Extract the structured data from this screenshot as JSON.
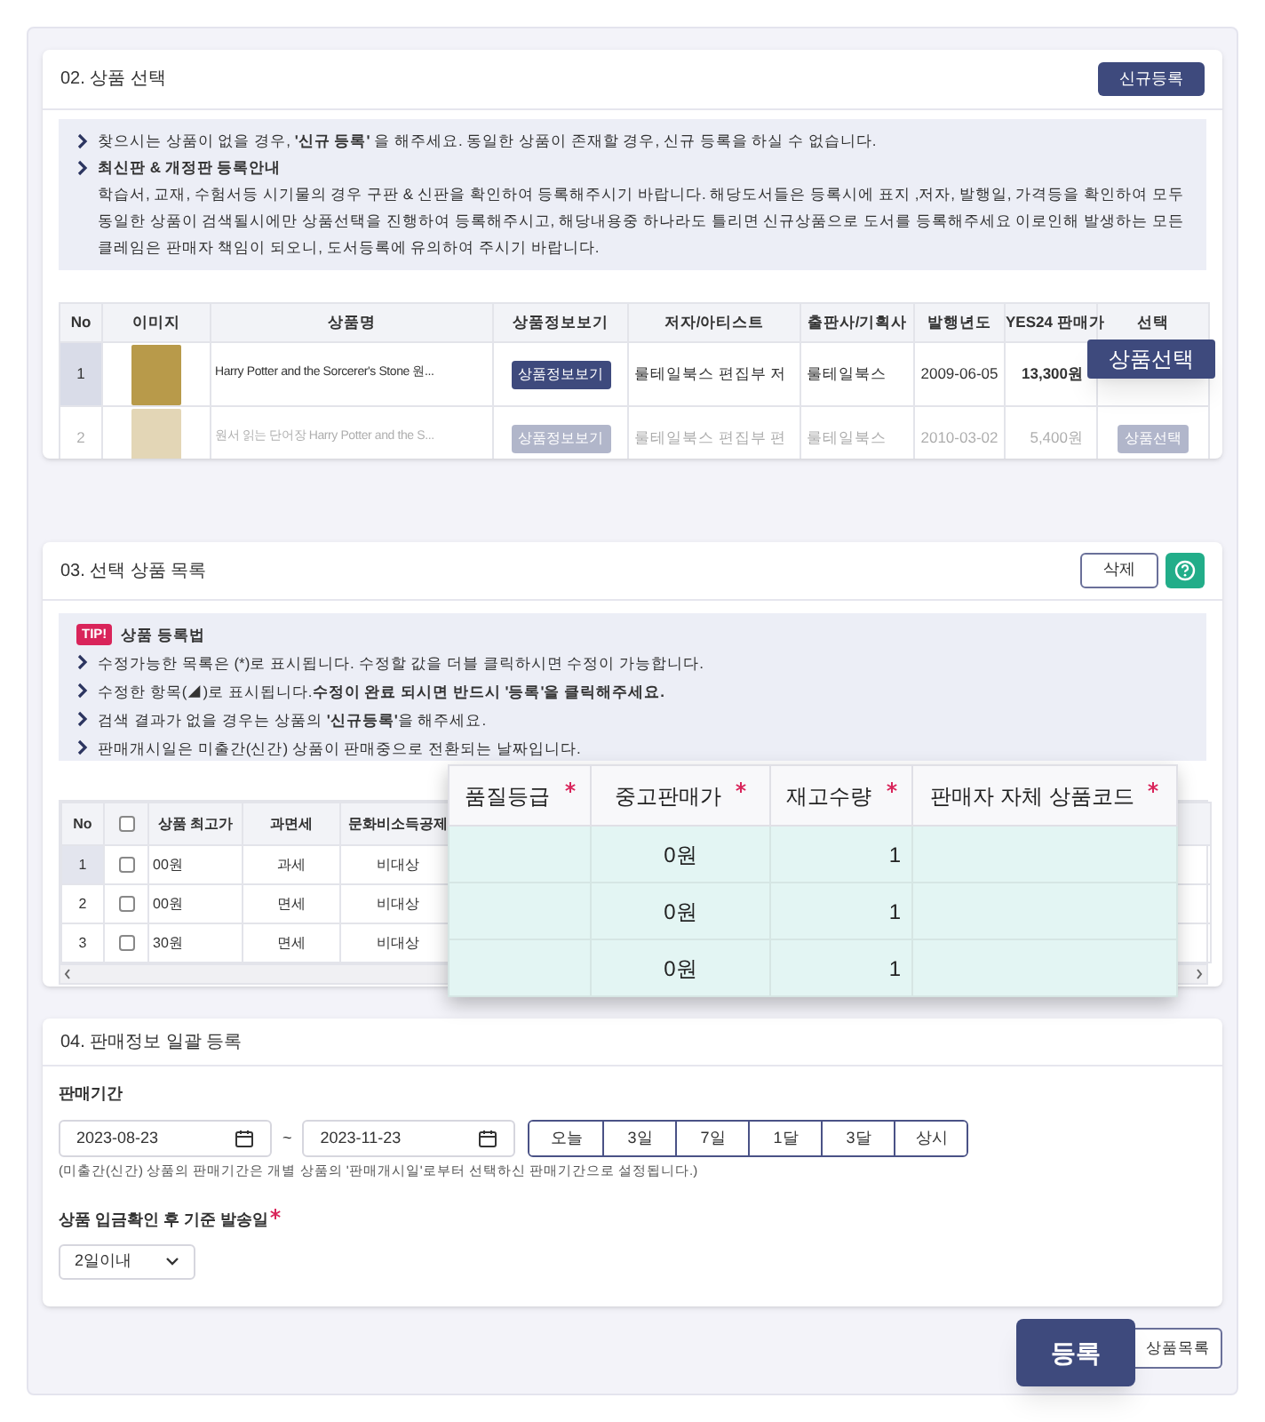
{
  "product_select": {
    "title": "02. 상품 선택",
    "new_button": "신규등록",
    "notices": [
      {
        "kind": "bullet",
        "text": "찾으시는 상품이 없을 경우, **'신규 등록'** 을 해주세요. 동일한 상품이 존재할 경우, 신규 등록을 하실 수 없습니다."
      },
      {
        "kind": "heading",
        "title": "최신판 & 개정판 등록안내",
        "body": "학습서, 교재, 수험서등 시기물의 경우 구판 & 신판을 확인하여 등록해주시기 바랍니다. 해당도서들은 등록시에 표지 ,저자, 발행일, 가격등을 확인하여 모두 동일한 상품이 검색될시에만 상품선택을 진행하여 등록해주시고, 해당내용중 하나라도 틀리면 신규상품으로 도서를 등록해주세요 이로인해 발생하는 모든 클레임은 판매자 책임이 되오니, 도서등록에 유의하여 주시기 바랍니다."
      }
    ],
    "columns": [
      "No",
      "이미지",
      "상품명",
      "상품정보보기",
      "저자/아티스트",
      "출판사/기획사",
      "발행년도",
      "YES24 판매가",
      "선택"
    ],
    "rows": [
      {
        "no": "1",
        "selected": true,
        "dimmed": false,
        "title": "Harry Potter and the Sorcerer's Stone 원...",
        "info_button": "상품정보보기",
        "author": "룰테일북스 편집부 저",
        "publisher": "룰테일북스",
        "date": "2009-06-05",
        "price": "13,300원"
      },
      {
        "no": "2",
        "selected": false,
        "dimmed": true,
        "title": "원서 읽는 단어장 Harry Potter and the S...",
        "info_button": "상품정보보기",
        "author": "룰테일북스 편집부 편",
        "publisher": "룰테일북스",
        "date": "2010-03-02",
        "price": "5,400원",
        "select_button": "상품선택"
      }
    ],
    "callout": "상품선택"
  },
  "selected_list": {
    "title": "03. 선택 상품 목록",
    "delete_button": "삭제",
    "tip_badge": "TIP!",
    "tip_title": "상품 등록법",
    "tips": [
      "수정가능한 목록은 (*)로 표시됩니다. 수정할 값을 더블 클릭하시면 수정이 가능합니다.",
      "수정한 항목(◢)로 표시됩니다.**수정이 완료 되시면 반드시 '등록'을 클릭해주세요.**",
      "검색 결과가 없을 경우는 상품의 **'신규등록'**을 해주세요.",
      "판매개시일은 미출간(신간) 상품이 판매중으로 전환되는 날짜입니다."
    ],
    "columns": [
      "No",
      "상품 최고가",
      "과면세",
      "문화비소득공제"
    ],
    "all_checked": false,
    "rows": [
      {
        "no": "1",
        "selected": true,
        "checked": false,
        "price": "00원",
        "tax": "과세",
        "culture": "비대상"
      },
      {
        "no": "2",
        "selected": false,
        "checked": false,
        "price": "00원",
        "tax": "면세",
        "culture": "비대상"
      },
      {
        "no": "3",
        "selected": false,
        "checked": false,
        "price": "30원",
        "tax": "면세",
        "culture": "비대상"
      }
    ],
    "popup": {
      "columns": [
        "품질등급",
        "중고판매가",
        "재고수량",
        "판매자 자체 상품코드"
      ],
      "rows": [
        {
          "price": "0원",
          "stock": "1"
        },
        {
          "price": "0원",
          "stock": "1"
        },
        {
          "price": "0원",
          "stock": "1"
        }
      ]
    }
  },
  "bulk_sales": {
    "title": "04. 판매정보 일괄 등록",
    "period_label": "판매기간",
    "start_date": "2023-08-23",
    "tilde": "~",
    "end_date": "2023-11-23",
    "periods": [
      "오늘",
      "3일",
      "7일",
      "1달",
      "3달",
      "상시"
    ],
    "note": "(미출간(신간) 상품의 판매기간은 개별 상품의 '판매개시일'로부터 선택하신 판매기간으로 설정됩니다.)",
    "ship_label": "상품 입금확인 후 기준 발송일",
    "ship_value": "2일이내"
  },
  "footer": {
    "register_button": "등록",
    "list_button": "상품목록"
  }
}
